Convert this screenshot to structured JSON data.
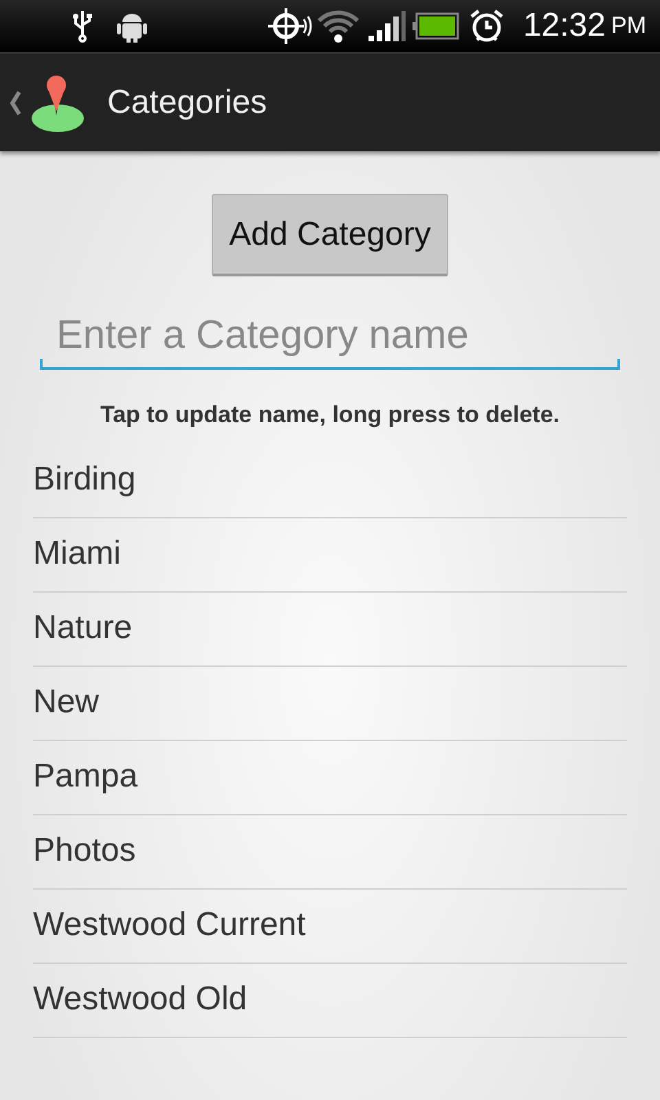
{
  "status_bar": {
    "time": "12:32",
    "ampm": "PM"
  },
  "action_bar": {
    "title": "Categories"
  },
  "add_button": {
    "label": "Add Category"
  },
  "name_field": {
    "placeholder": "Enter a Category name",
    "focused": true
  },
  "hint": "Tap to update name, long press to delete.",
  "categories": [
    {
      "name": "Birding"
    },
    {
      "name": "Miami"
    },
    {
      "name": "Nature"
    },
    {
      "name": "New"
    },
    {
      "name": "Pampa"
    },
    {
      "name": "Photos"
    },
    {
      "name": "Westwood Current"
    },
    {
      "name": "Westwood Old"
    }
  ]
}
